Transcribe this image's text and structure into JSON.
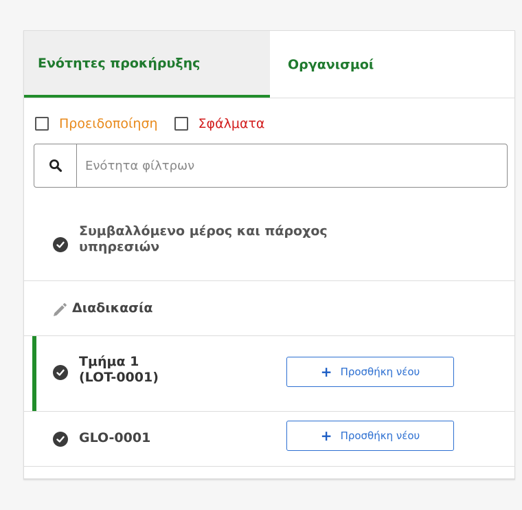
{
  "tabs": [
    {
      "label": "Ενότητες προκήρυξης",
      "active": true
    },
    {
      "label": "Οργανισμοί",
      "active": false
    }
  ],
  "filters": {
    "warning_label": "Προειδοποίηση",
    "errors_label": "Σφάλματα",
    "warning_checked": false,
    "errors_checked": false
  },
  "search": {
    "placeholder": "Ενότητα φίλτρων",
    "value": ""
  },
  "sections": [
    {
      "label": "Συμβαλλόμενο μέρος και πάροχος υπηρεσιών",
      "status_icon": "check-circle-icon"
    },
    {
      "label": "Διαδικασία",
      "status_icon": "pencil-icon"
    },
    {
      "label_line1": "Τμήμα 1",
      "label_line2": "(LOT-0001)",
      "status_icon": "check-circle-icon",
      "selected": true,
      "add_button": "Προσθήκη νέου"
    },
    {
      "label": "GLO-0001",
      "status_icon": "check-circle-icon",
      "add_button": "Προσθήκη νέου"
    }
  ],
  "colors": {
    "tab_text": "#1f7a2e",
    "active_indicator": "#218d2b",
    "warning": "#e8891a",
    "error": "#d21d1d",
    "button_blue": "#2c6fd1"
  }
}
